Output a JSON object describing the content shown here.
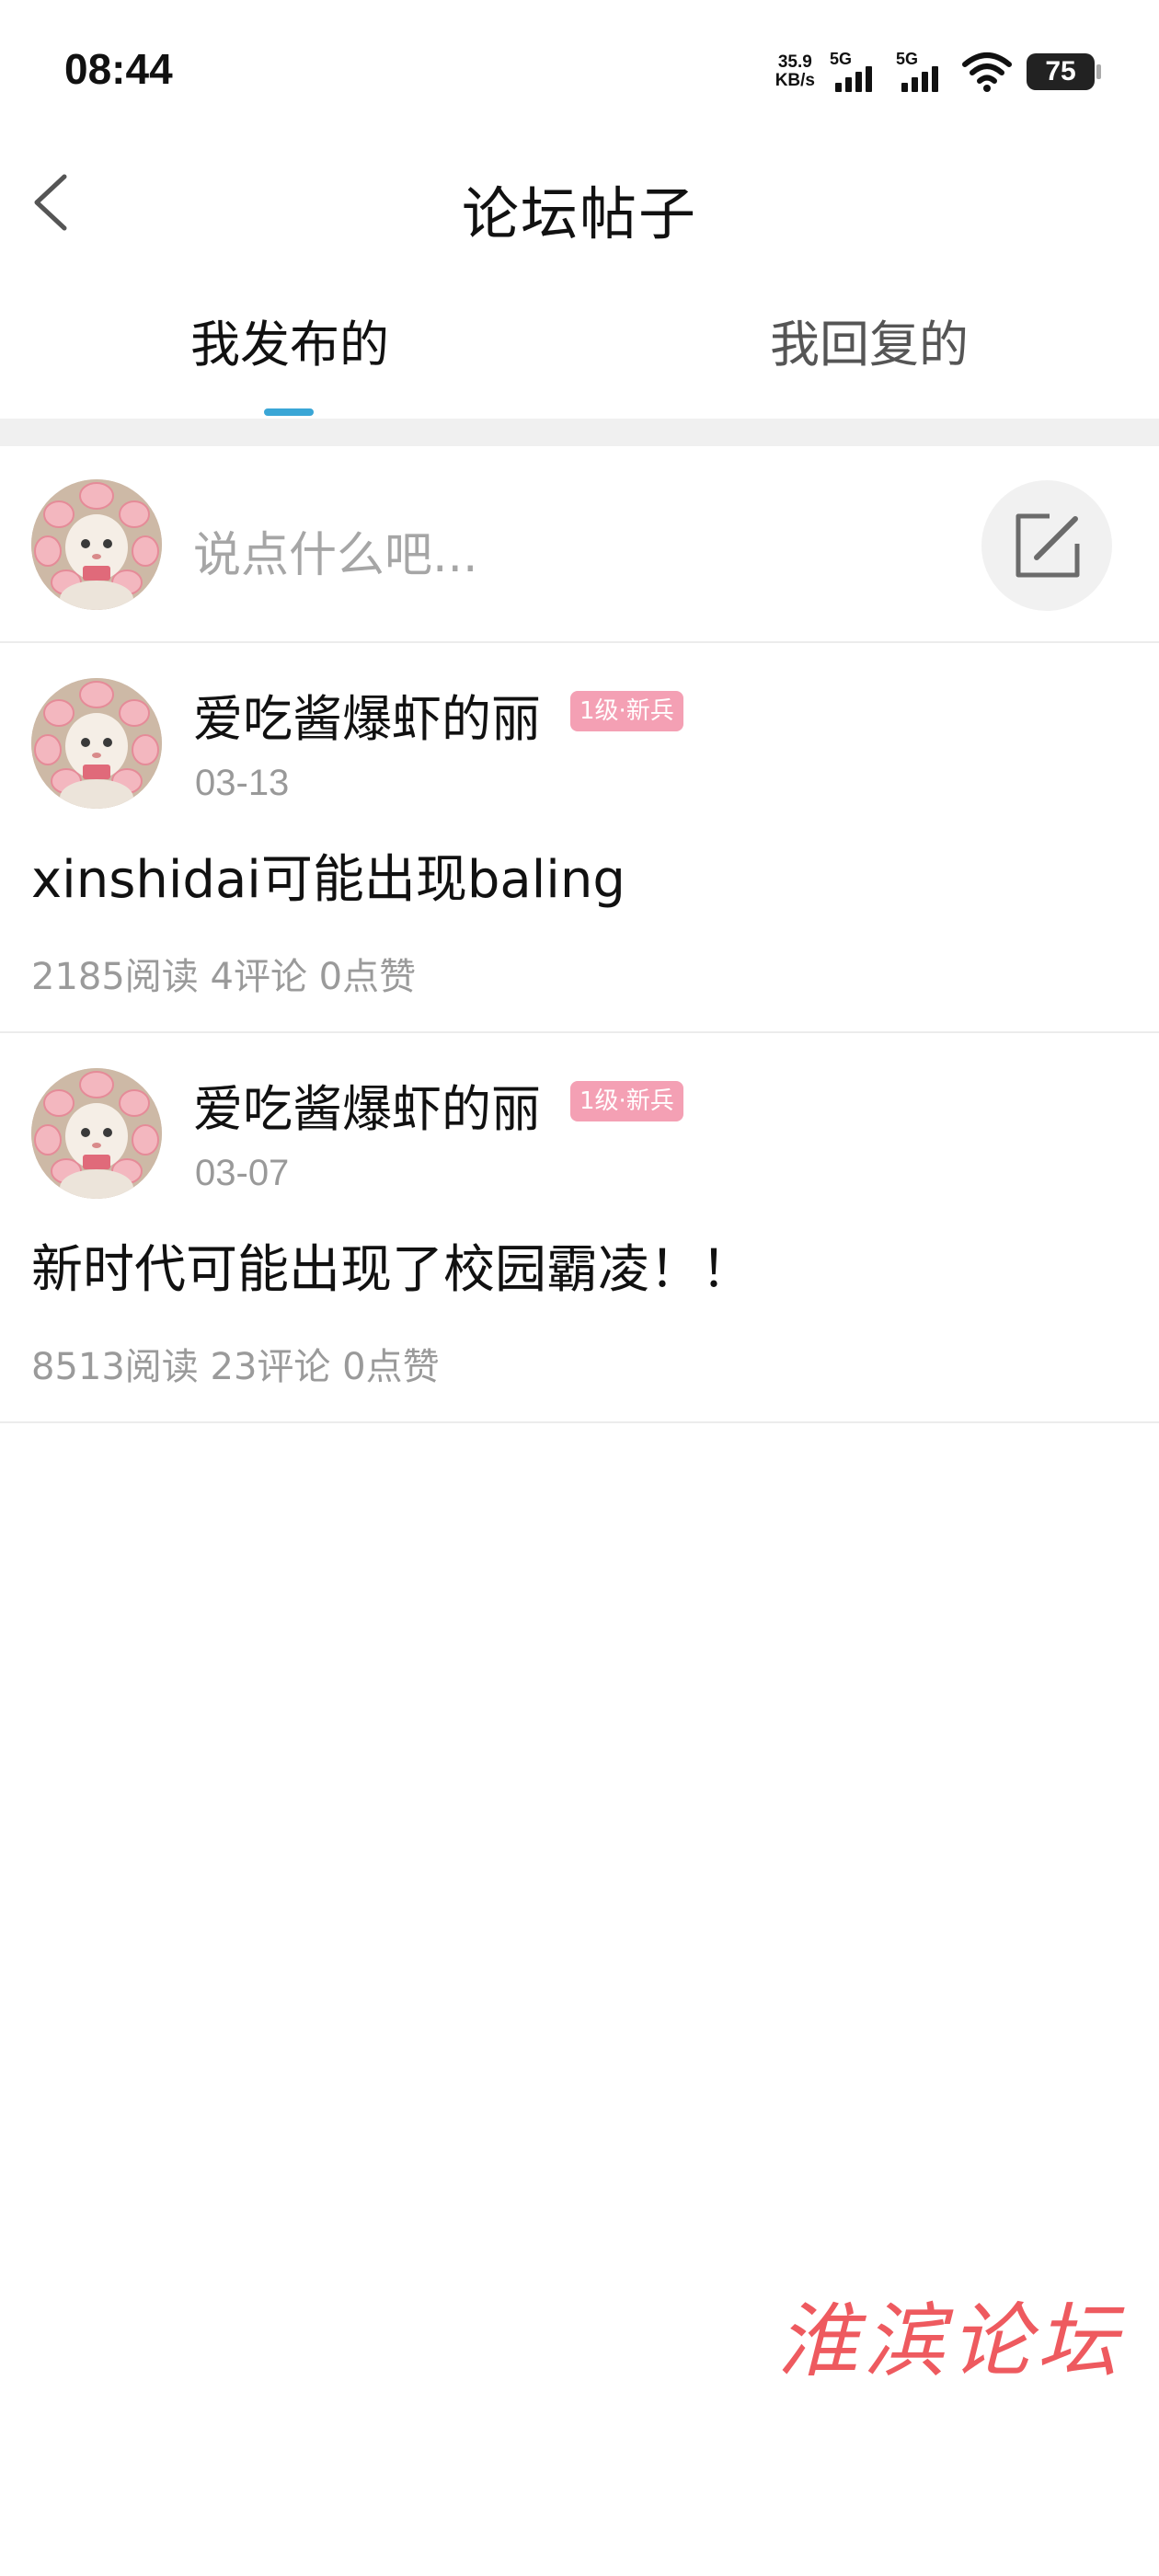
{
  "status_bar": {
    "time": "08:44",
    "net_speed_value": "35.9",
    "net_speed_unit": "KB/s",
    "signal1_label": "5G",
    "signal2_label": "5G",
    "battery_level": "75"
  },
  "nav": {
    "title": "论坛帖子",
    "back_icon": "chevron-left-icon"
  },
  "tabs": [
    {
      "label": "我发布的",
      "active": true
    },
    {
      "label": "我回复的",
      "active": false
    }
  ],
  "accent_color": "#3aa6d6",
  "composer": {
    "placeholder": "说点什么吧...",
    "compose_icon": "edit-icon"
  },
  "posts": [
    {
      "author": "爱吃酱爆虾的丽",
      "level_badge": "1级·新兵",
      "date": "03-13",
      "text": "xinshidai可能出现baling",
      "stats": "2185阅读 4评论 0点赞"
    },
    {
      "author": "爱吃酱爆虾的丽",
      "level_badge": "1级·新兵",
      "date": "03-07",
      "text": "新时代可能出现了校园霸凌！！",
      "stats": "8513阅读 23评论 0点赞"
    }
  ],
  "watermark": "淮滨论坛"
}
